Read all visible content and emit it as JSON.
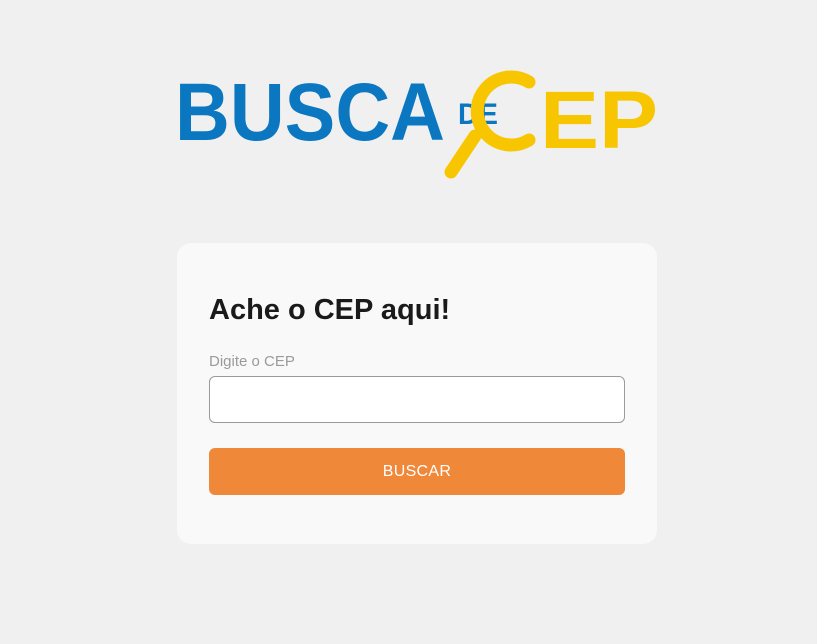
{
  "logo": {
    "word_busca": "BUSCA",
    "word_de": "DE",
    "word_cep": "EP",
    "blue": "#0a77c0",
    "yellow": "#f7c600",
    "icon": "magnifier-icon"
  },
  "card": {
    "title": "Ache o CEP aqui!",
    "input_label": "Digite o CEP",
    "input_value": "",
    "input_placeholder": "",
    "button_label": "BUSCAR",
    "button_color": "#f0883a"
  }
}
